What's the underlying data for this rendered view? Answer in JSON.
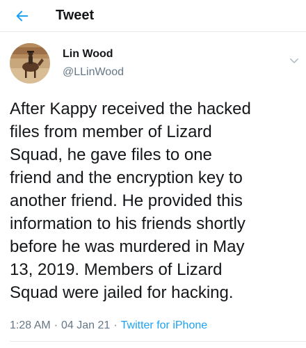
{
  "header": {
    "title": "Tweet",
    "back_icon": "arrow-left-icon",
    "accent_color": "#1da1f2"
  },
  "author": {
    "display_name": "Lin Wood",
    "handle": "@LLinWood",
    "avatar": "horse-rider-avatar",
    "menu_icon": "chevron-down-icon"
  },
  "tweet": {
    "text": "After Kappy received the hacked\nfiles from member of Lizard\nSquad, he gave files to one\nfriend and the encryption key to\nanother friend. He provided this\ninformation to his friends shortly\nbefore he was murdered in May\n13, 2019. Members of Lizard\nSquad were jailed for hacking.",
    "time": "1:28 AM",
    "separator": "·",
    "date": "04 Jan 21",
    "source": "Twitter for iPhone"
  }
}
